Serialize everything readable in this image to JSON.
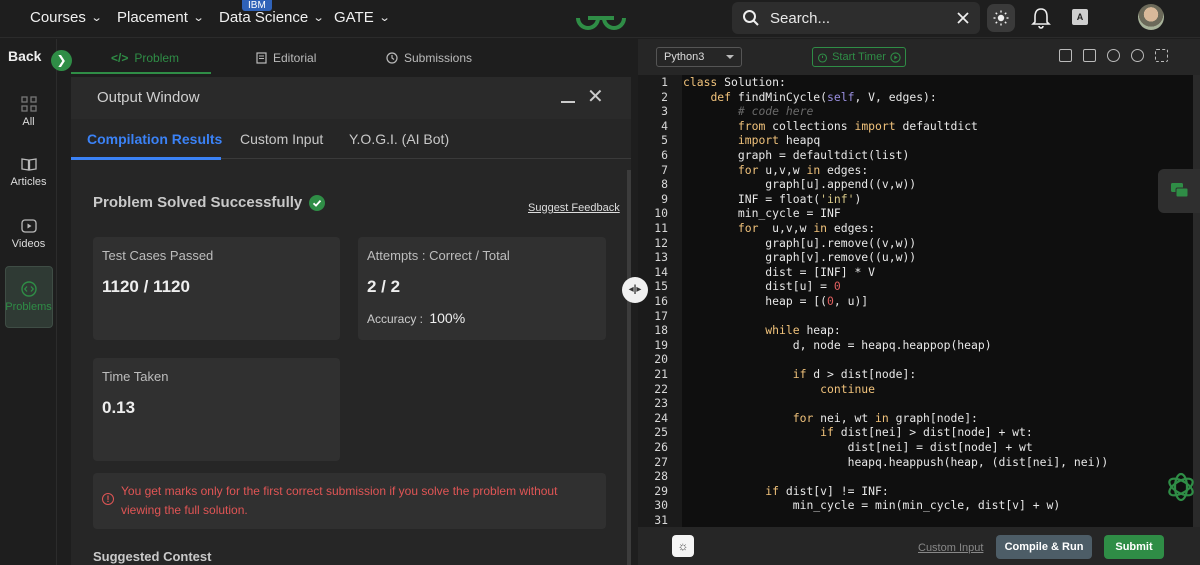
{
  "topnav": {
    "courses": "Courses",
    "placement": "Placement",
    "data_science": "Data Science",
    "ibm_badge": "IBM",
    "gate": "GATE",
    "search_placeholder": "Search..."
  },
  "sidebar": {
    "back": "Back",
    "items": [
      {
        "label": "All",
        "icon": "grid-icon"
      },
      {
        "label": "Articles",
        "icon": "book-icon"
      },
      {
        "label": "Videos",
        "icon": "play-icon"
      },
      {
        "label": "Problems",
        "icon": "code-icon"
      }
    ]
  },
  "tabs": {
    "problem": "Problem",
    "editorial": "Editorial",
    "submissions": "Submissions"
  },
  "output": {
    "title": "Output Window",
    "subtabs": [
      "Compilation Results",
      "Custom Input",
      "Y.O.G.I. (AI Bot)"
    ],
    "solved": "Problem Solved Successfully",
    "feedback": "Suggest Feedback",
    "cards": {
      "tests_label": "Test Cases Passed",
      "tests_value": "1120 / 1120",
      "attempts_label": "Attempts : Correct / Total",
      "attempts_value": "2 / 2",
      "accuracy_label": "Accuracy :",
      "accuracy_value": "100%",
      "time_label": "Time Taken",
      "time_value": "0.13"
    },
    "warning": "You get marks only for the first correct submission if you solve the problem without viewing the full solution.",
    "suggested": "Suggested Contest"
  },
  "editor": {
    "language": "Python3",
    "timer": "Start Timer",
    "custom_input": "Custom Input",
    "compile": "Compile & Run",
    "submit": "Submit"
  },
  "colors": {
    "accent_green": "#2f8d46",
    "accent_blue": "#3b82f6",
    "error_red": "#e05555"
  }
}
